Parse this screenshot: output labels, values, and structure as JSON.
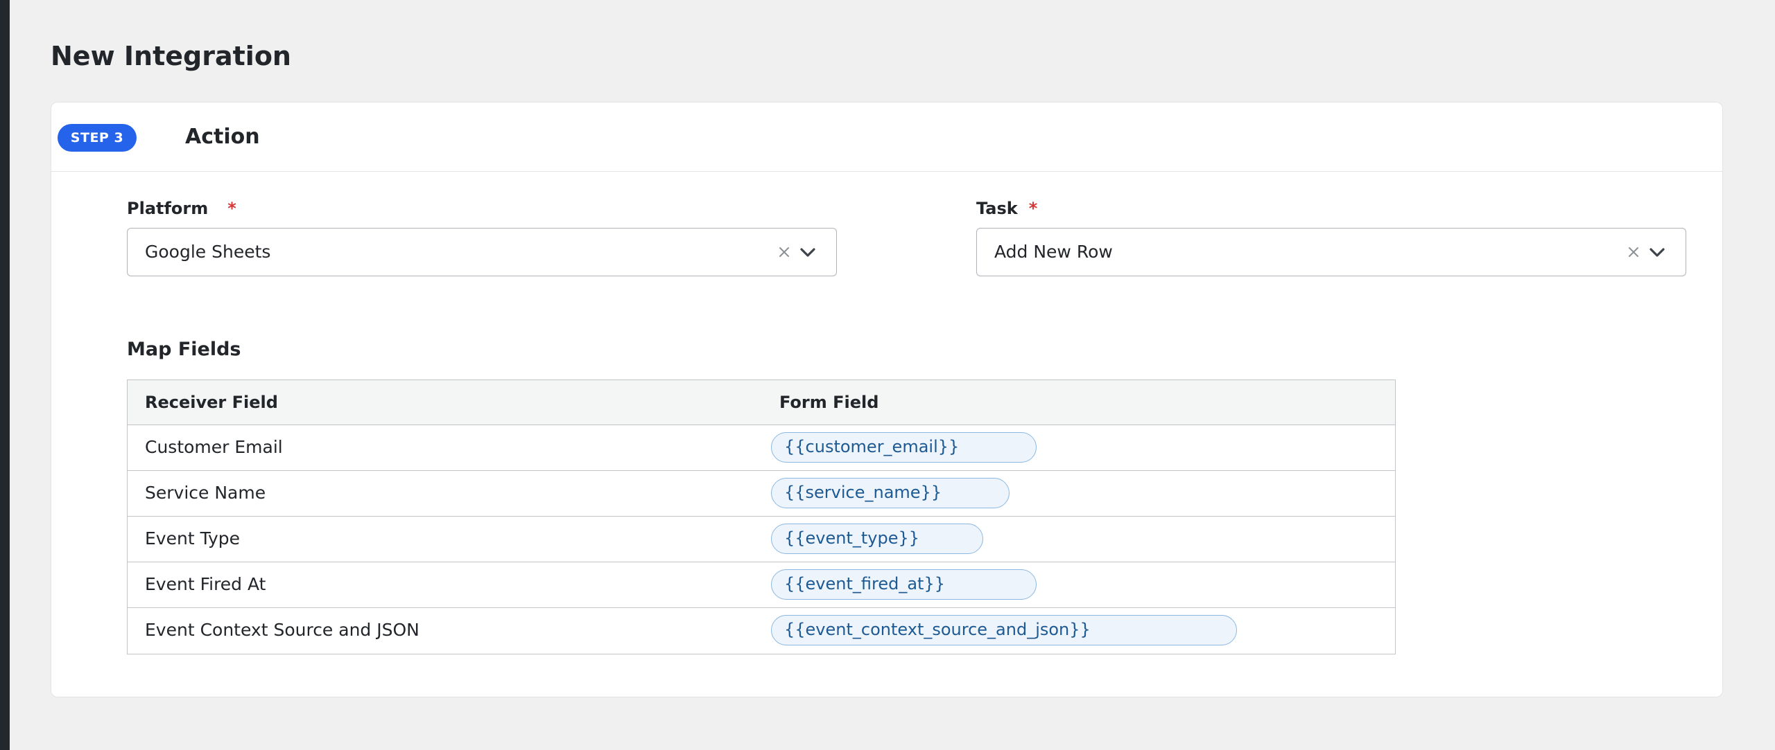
{
  "page": {
    "title": "New Integration"
  },
  "step": {
    "badge": "STEP 3",
    "title": "Action"
  },
  "platform": {
    "label": "Platform",
    "required_mark": "*",
    "value": "Google Sheets"
  },
  "task": {
    "label": "Task",
    "required_mark": "*",
    "value": "Add New Row"
  },
  "map_fields": {
    "title": "Map Fields",
    "columns": [
      "Receiver Field",
      "Form Field"
    ],
    "rows": [
      {
        "receiver": "Customer Email",
        "token": "{{customer_email}}"
      },
      {
        "receiver": "Service Name",
        "token": "{{service_name}}"
      },
      {
        "receiver": "Event Type",
        "token": "{{event_type}}"
      },
      {
        "receiver": "Event Fired At",
        "token": "{{event_fired_at}}"
      },
      {
        "receiver": "Event Context Source and JSON",
        "token": "{{event_context_source_and_json}}"
      }
    ]
  },
  "icons": {
    "clear": "close-icon",
    "dropdown": "chevron-down-icon"
  },
  "colors": {
    "accent": "#2563eb",
    "required": "#d63638",
    "token_text": "#1d5a94",
    "token_bg": "#eef4fb",
    "token_border": "#8cb8e2"
  }
}
